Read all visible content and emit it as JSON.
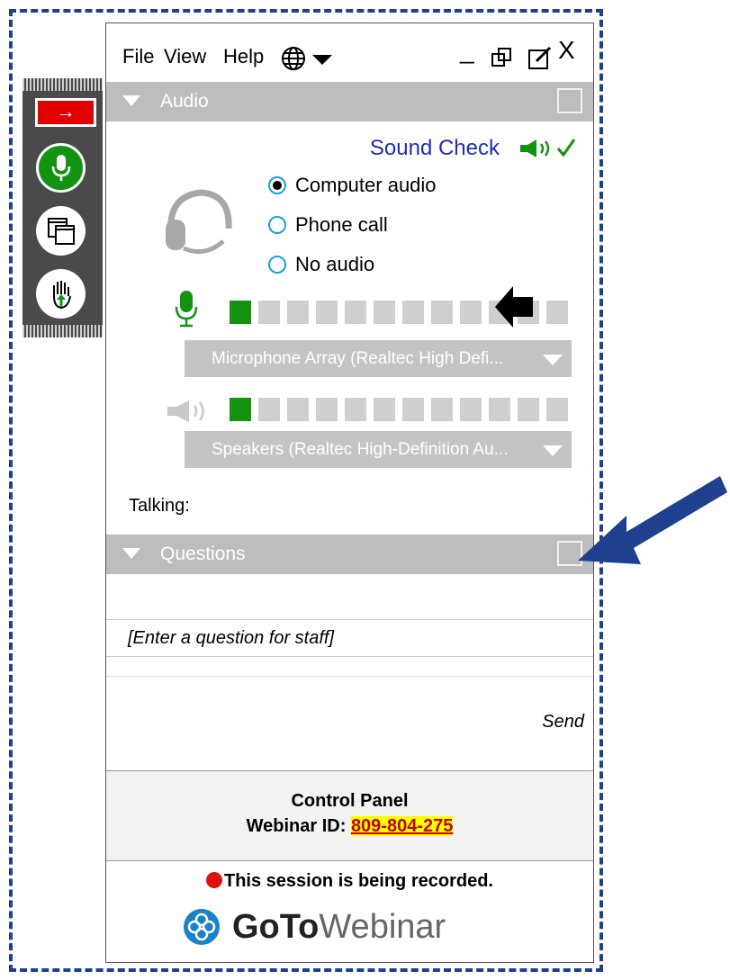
{
  "menu": {
    "file": "File",
    "view": "View",
    "help": "Help"
  },
  "window_controls": {
    "minimize": "_",
    "close": "X"
  },
  "audio_section": {
    "title": "Audio",
    "sound_check": "Sound Check",
    "options": [
      {
        "label": "Computer audio",
        "selected": true
      },
      {
        "label": "Phone call",
        "selected": false
      },
      {
        "label": "No audio",
        "selected": false
      }
    ],
    "mic_level_segments_on": 1,
    "speaker_level_segments_on": 1,
    "segments_total": 12,
    "microphone_device": "Microphone Array (Realtec High Defi...",
    "speaker_device": "Speakers (Realtec High-Definition Au..."
  },
  "talking_label": "Talking:",
  "questions_section": {
    "title": "Questions",
    "input_placeholder": "[Enter a question for staff]",
    "send_label": "Send"
  },
  "footer": {
    "control_panel": "Control Panel",
    "webinar_id_label": "Webinar ID:",
    "webinar_id": "809-804-275",
    "recording_notice": "This session is being recorded."
  },
  "brand": {
    "part1": "GoTo",
    "part2": "Webinar"
  },
  "colors": {
    "frame": "#1f3f8f",
    "accent_green": "#129312",
    "section_gray": "#bdbdbd",
    "sound_check_blue": "#1f2fb0"
  }
}
